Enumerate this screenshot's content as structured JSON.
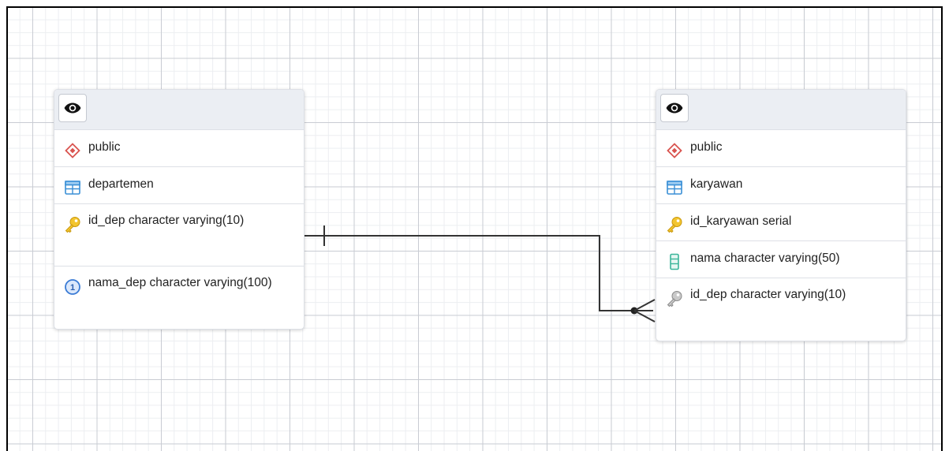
{
  "tables": [
    {
      "schema": "public",
      "name": "departemen",
      "columns": [
        {
          "text": "id_dep character varying(10)",
          "icon": "primary-key-icon"
        },
        {
          "text": "nama_dep character varying(100)",
          "icon": "column-number-icon"
        }
      ]
    },
    {
      "schema": "public",
      "name": "karyawan",
      "columns": [
        {
          "text": "id_karyawan serial",
          "icon": "primary-key-icon"
        },
        {
          "text": "nama character varying(50)",
          "icon": "column-icon"
        },
        {
          "text": "id_dep character varying(10)",
          "icon": "foreign-key-icon"
        }
      ]
    }
  ],
  "relationship": {
    "from": "departemen.id_dep",
    "to": "karyawan.id_dep",
    "from_cardinality": "one",
    "to_cardinality": "many"
  },
  "colors": {
    "schema_icon": "#d9534f",
    "table_icon": "#3a8fd6",
    "primary_key": "#e8b923",
    "foreign_key": "#9a9a9a",
    "column_icon": "#3bb59a",
    "number_icon": "#3a7bd5",
    "link_line": "#333333"
  }
}
